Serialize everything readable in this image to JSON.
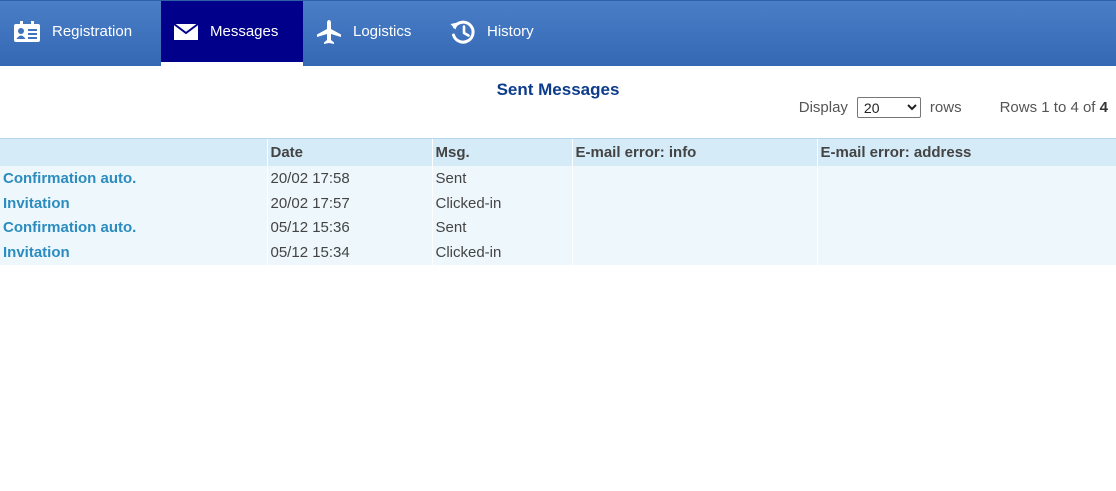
{
  "nav": {
    "tabs": [
      {
        "label": "Registration",
        "icon": "id-card-icon",
        "active": false
      },
      {
        "label": "Messages",
        "icon": "envelope-icon",
        "active": true
      },
      {
        "label": "Logistics",
        "icon": "airplane-icon",
        "active": false
      },
      {
        "label": "History",
        "icon": "history-clock-icon",
        "active": false
      }
    ],
    "colors": {
      "bar": "#3f73bd",
      "active": "#00008a"
    }
  },
  "page": {
    "title": "Sent Messages"
  },
  "pagination": {
    "display_label": "Display",
    "rows_per_page": "20",
    "rows_label": "rows",
    "rows_info_prefix": "Rows 1 to 4 of",
    "rows_total": "4"
  },
  "table": {
    "columns": [
      "",
      "Date",
      "Msg.",
      "E-mail error: info",
      "E-mail error: address"
    ],
    "rows": [
      {
        "name": "Confirmation auto.",
        "date": "20/02 17:58",
        "msg": "Sent",
        "error_info": "",
        "error_address": ""
      },
      {
        "name": "Invitation",
        "date": "20/02 17:57",
        "msg": "Clicked-in",
        "error_info": "",
        "error_address": ""
      },
      {
        "name": "Confirmation auto.",
        "date": "05/12 15:36",
        "msg": "Sent",
        "error_info": "",
        "error_address": ""
      },
      {
        "name": "Invitation",
        "date": "05/12 15:34",
        "msg": "Clicked-in",
        "error_info": "",
        "error_address": ""
      }
    ],
    "colors": {
      "header_bg": "#d5ebf8",
      "row_bg": "#eef7fc",
      "link": "#2a8cbf"
    }
  }
}
